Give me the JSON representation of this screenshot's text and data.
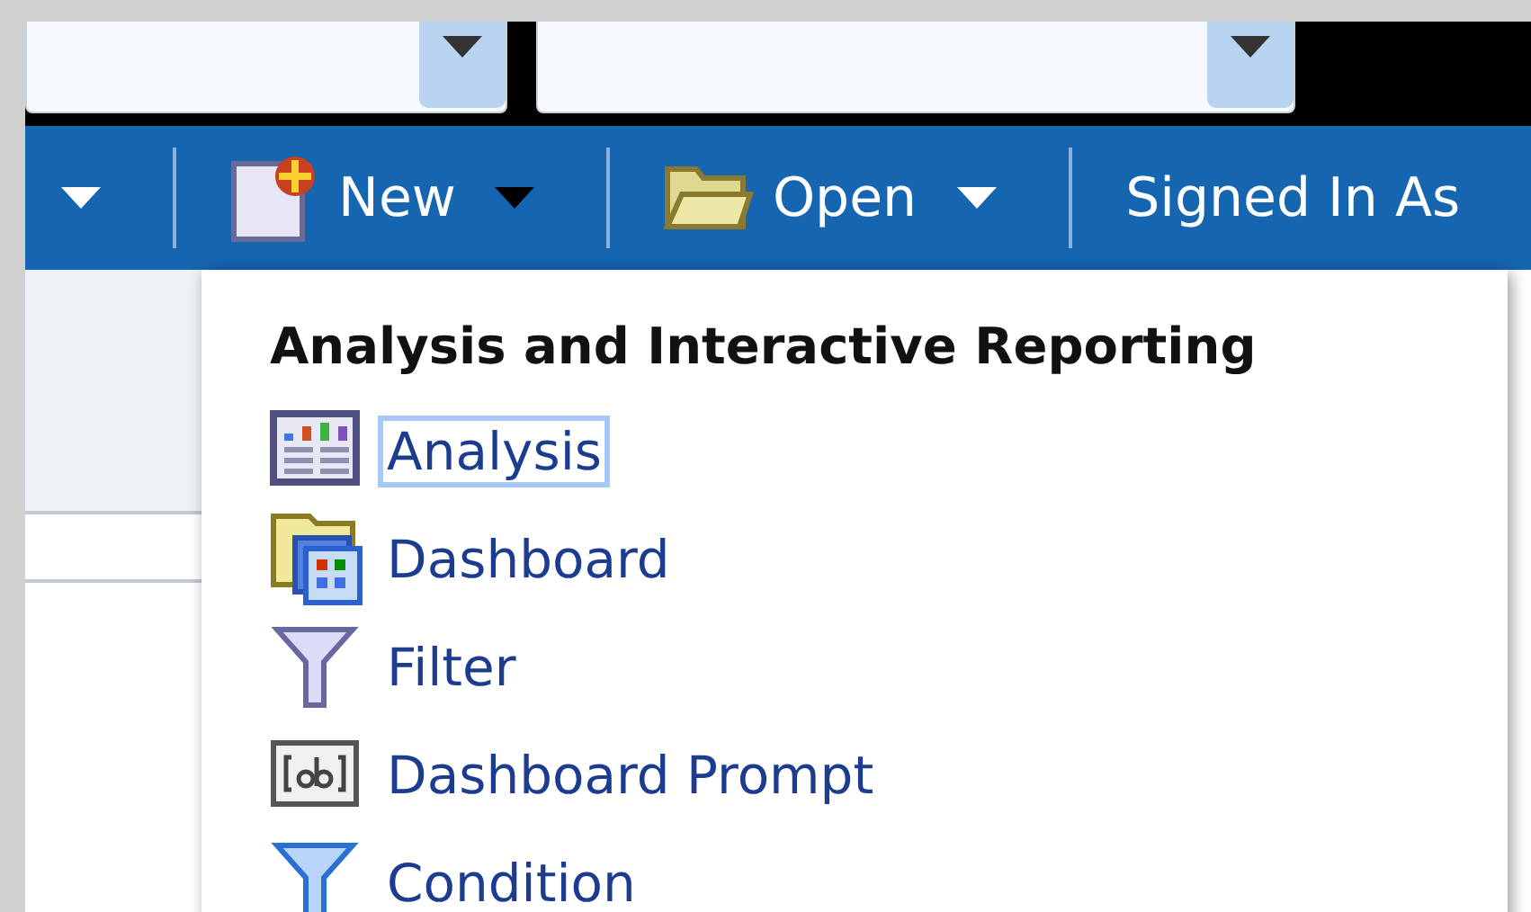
{
  "toolbar": {
    "items": [
      {
        "kind": "new",
        "label": "New"
      },
      {
        "kind": "open",
        "label": "Open"
      },
      {
        "kind": "text",
        "label": "Signed In As"
      }
    ]
  },
  "new_menu": {
    "heading": "Analysis and Interactive Reporting",
    "items": [
      {
        "kind": "analysis",
        "label": "Analysis",
        "selected": true
      },
      {
        "kind": "dashboard",
        "label": "Dashboard",
        "selected": false
      },
      {
        "kind": "filter",
        "label": "Filter",
        "selected": false
      },
      {
        "kind": "prompt",
        "label": "Dashboard Prompt",
        "selected": false
      },
      {
        "kind": "condition",
        "label": "Condition",
        "selected": false
      }
    ]
  }
}
